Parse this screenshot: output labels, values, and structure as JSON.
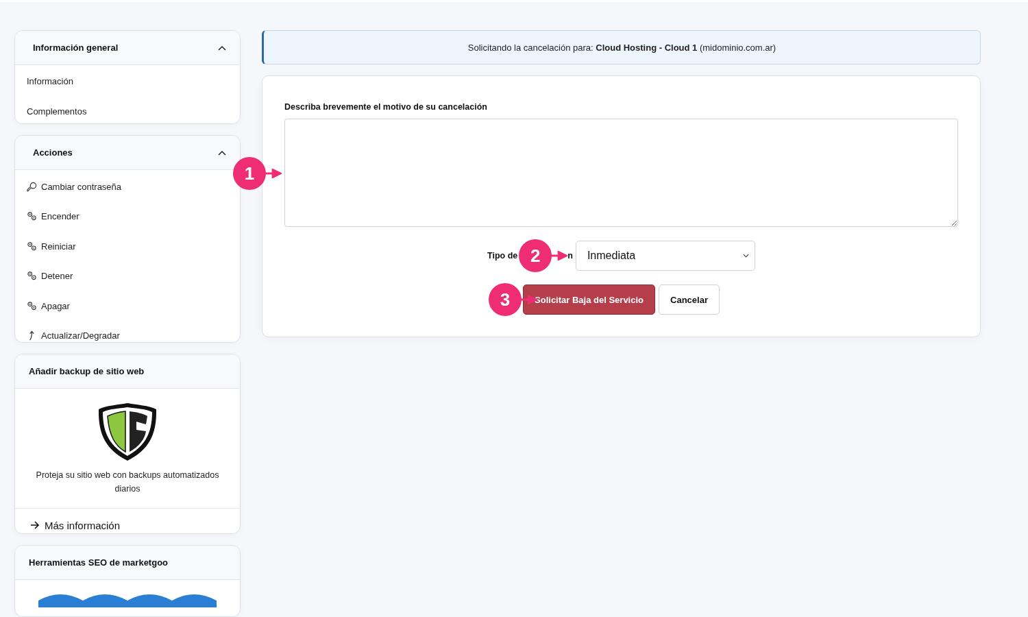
{
  "sidebar": {
    "panels": [
      {
        "kind": "menu",
        "title": "Información general",
        "expanded": true,
        "items": [
          {
            "label": "Información"
          },
          {
            "label": "Complementos"
          }
        ]
      },
      {
        "kind": "actions",
        "title": "Acciones",
        "expanded": true,
        "items": [
          {
            "label": "Cambiar contraseña"
          },
          {
            "label": "Encender"
          },
          {
            "label": "Reiniciar"
          },
          {
            "label": "Detener"
          },
          {
            "label": "Apagar"
          },
          {
            "label": "Actualizar/Degradar"
          }
        ]
      },
      {
        "kind": "promo",
        "title": "Añadir backup de sitio web",
        "text": "Proteja su sitio web con backups automatizados diarios",
        "link": "Más información"
      },
      {
        "kind": "promo",
        "title": "Herramientas SEO de marketgoo"
      }
    ]
  },
  "notice": "Solicitando la cancelación para: **Cloud Hosting - Cloud 1** (midominio.com.ar)",
  "form": {
    "reason_label": "Describa brevemente el motivo de su cancelación",
    "type_label_start": "Tipo de",
    "type_label_end": "n",
    "type_value": "Inmediata",
    "submit": "Solicitar Baja del Servicio",
    "cancel": "Cancelar"
  },
  "annotations": [
    {
      "number": "1"
    },
    {
      "number": "2"
    },
    {
      "number": "3"
    }
  ]
}
